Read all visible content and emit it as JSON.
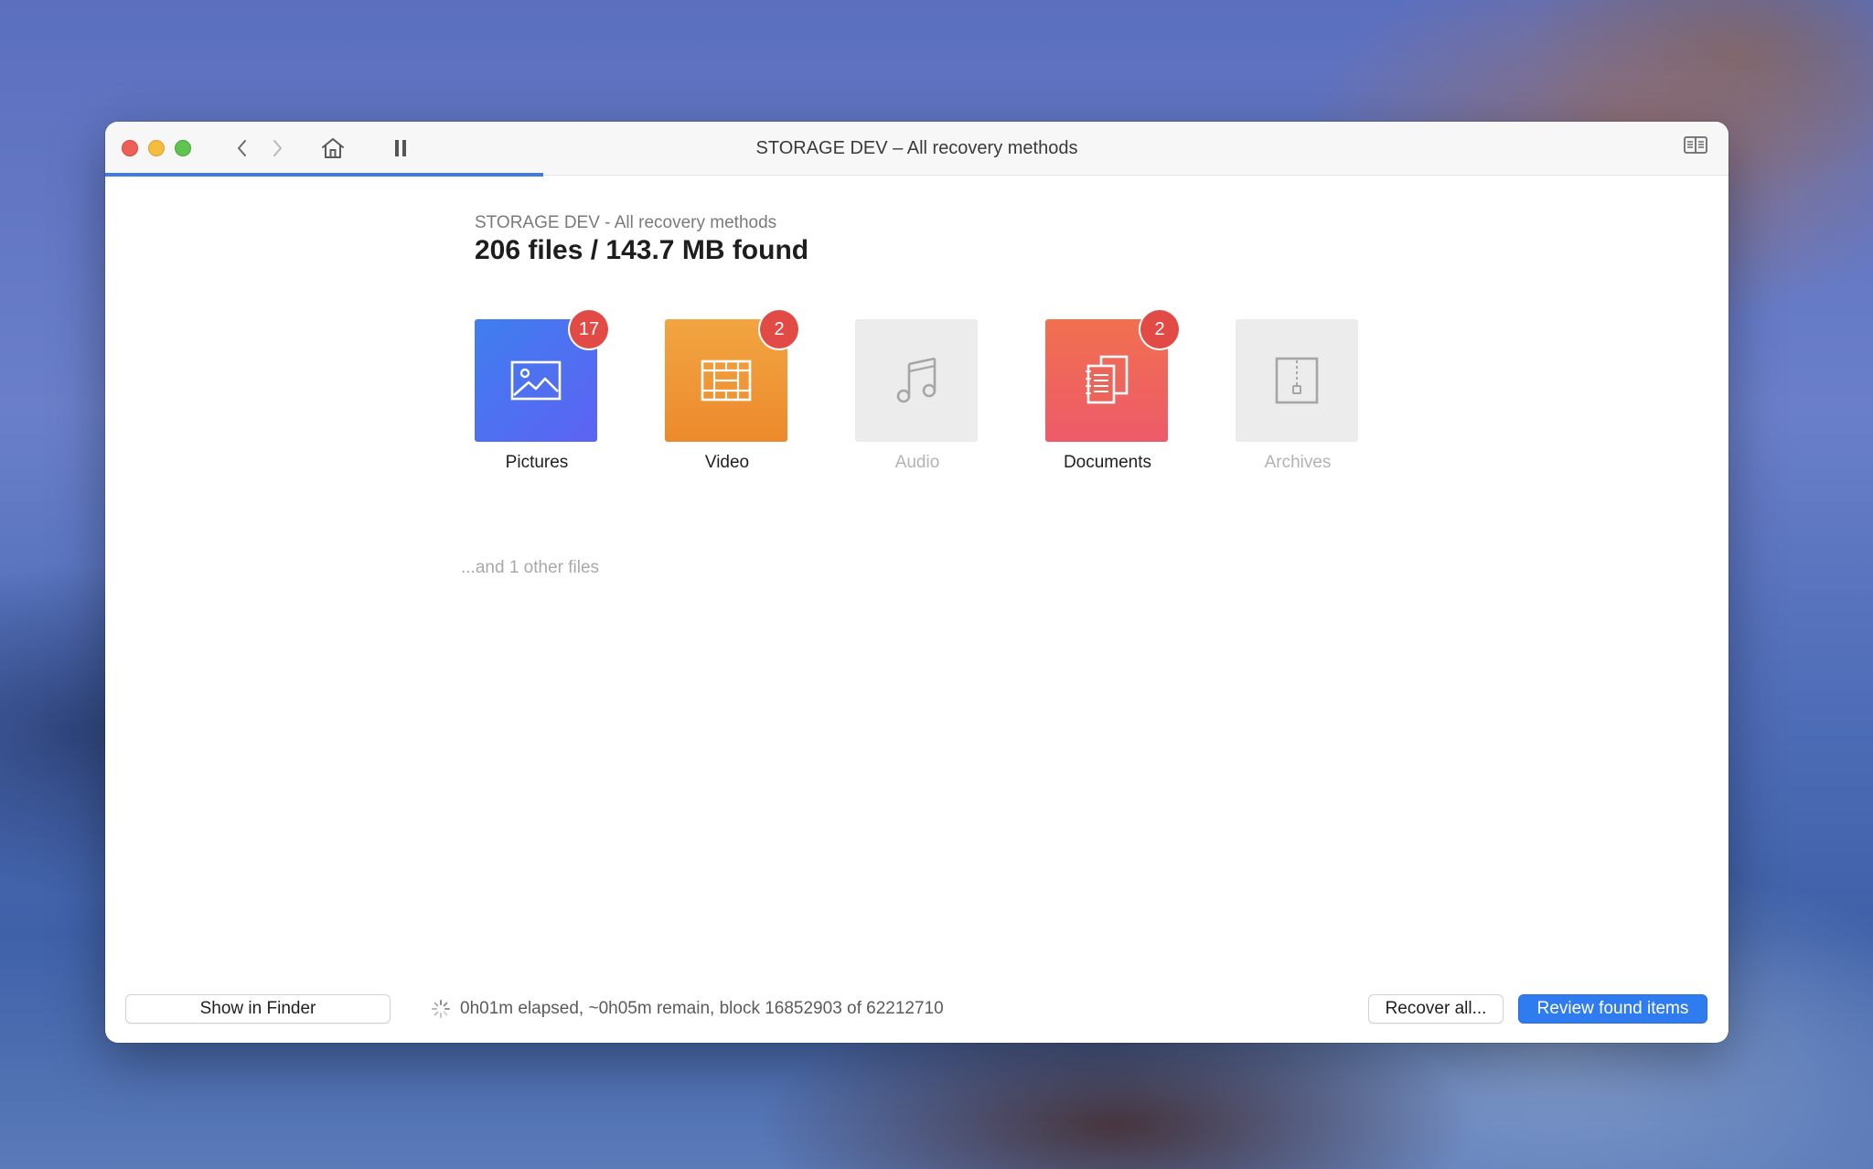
{
  "window": {
    "title": "STORAGE DEV – All recovery methods",
    "scan_progress": 0.27
  },
  "main": {
    "subtitle": "STORAGE DEV - All recovery methods",
    "headline": "206 files / 143.7 MB found",
    "other_files": "...and 1 other files",
    "categories": [
      {
        "label": "Pictures",
        "count": "17",
        "icon": "picture-icon",
        "enabled": true,
        "color": "#4a72f0"
      },
      {
        "label": "Video",
        "count": "2",
        "icon": "film-icon",
        "enabled": true,
        "color": "#ee922f"
      },
      {
        "label": "Audio",
        "count": "",
        "icon": "music-note-icon",
        "enabled": false,
        "color": "#ececec"
      },
      {
        "label": "Documents",
        "count": "2",
        "icon": "documents-icon",
        "enabled": true,
        "color": "#ef6458"
      },
      {
        "label": "Archives",
        "count": "",
        "icon": "zip-archive-icon",
        "enabled": false,
        "color": "#ececec"
      }
    ]
  },
  "footer": {
    "show_in_finder": "Show in Finder",
    "status": "0h01m elapsed, ~0h05m remain, block 16852903 of 62212710",
    "recover_all": "Recover all...",
    "review_found": "Review found items"
  },
  "colors": {
    "accent": "#2f7cf0",
    "badge": "#e24b45"
  }
}
